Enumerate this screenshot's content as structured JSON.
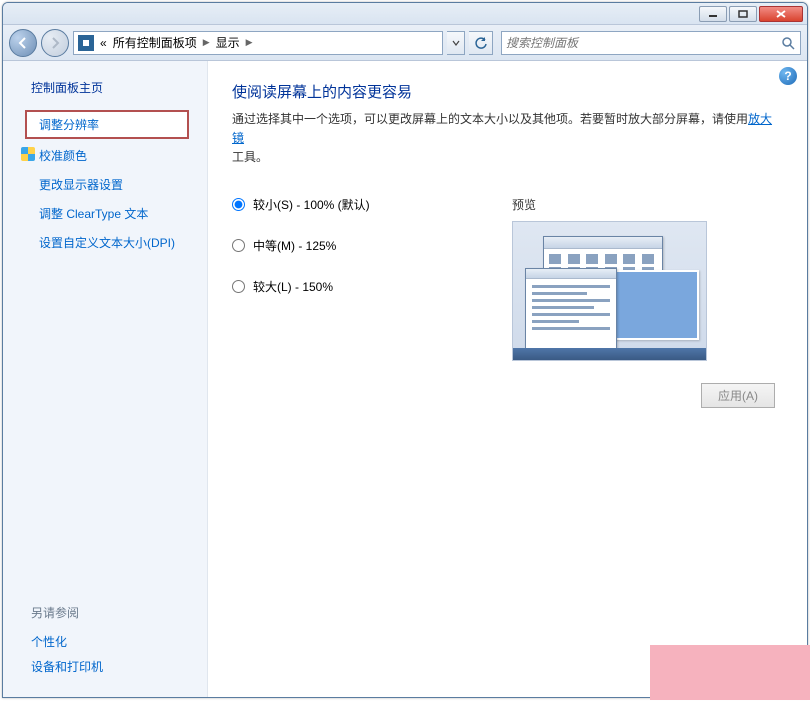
{
  "breadcrumb": {
    "prefix": "«",
    "item1": "所有控制面板项",
    "item2": "显示"
  },
  "search": {
    "placeholder": "搜索控制面板"
  },
  "sidebar": {
    "home": "控制面板主页",
    "items": [
      "调整分辨率",
      "校准颜色",
      "更改显示器设置",
      "调整 ClearType 文本",
      "设置自定义文本大小(DPI)"
    ],
    "seeAlso": "另请参阅",
    "foot": [
      "个性化",
      "设备和打印机"
    ]
  },
  "main": {
    "title": "使阅读屏幕上的内容更容易",
    "desc1": "通过选择其中一个选项，可以更改屏幕上的文本大小以及其他项。若要暂时放大部分屏幕，请使用",
    "linkMagnifier": "放大镜",
    "desc2": "工具。",
    "options": {
      "small": "较小(S) - 100% (默认)",
      "medium": "中等(M) - 125%",
      "large": "较大(L) - 150%"
    },
    "previewLabel": "预览",
    "applyLabel": "应用(A)"
  },
  "help": "?"
}
